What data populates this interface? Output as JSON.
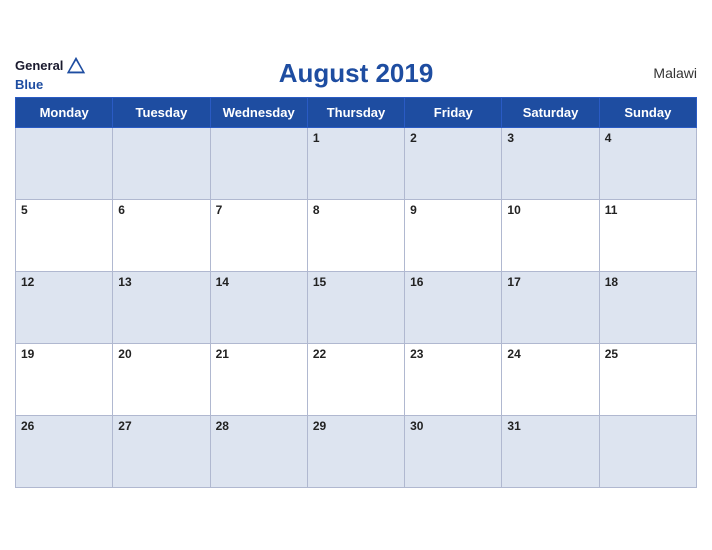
{
  "header": {
    "title": "August 2019",
    "country": "Malawi",
    "logo_general": "General",
    "logo_blue": "Blue"
  },
  "days_of_week": [
    "Monday",
    "Tuesday",
    "Wednesday",
    "Thursday",
    "Friday",
    "Saturday",
    "Sunday"
  ],
  "weeks": [
    [
      null,
      null,
      null,
      1,
      2,
      3,
      4
    ],
    [
      5,
      6,
      7,
      8,
      9,
      10,
      11
    ],
    [
      12,
      13,
      14,
      15,
      16,
      17,
      18
    ],
    [
      19,
      20,
      21,
      22,
      23,
      24,
      25
    ],
    [
      26,
      27,
      28,
      29,
      30,
      31,
      null
    ]
  ]
}
